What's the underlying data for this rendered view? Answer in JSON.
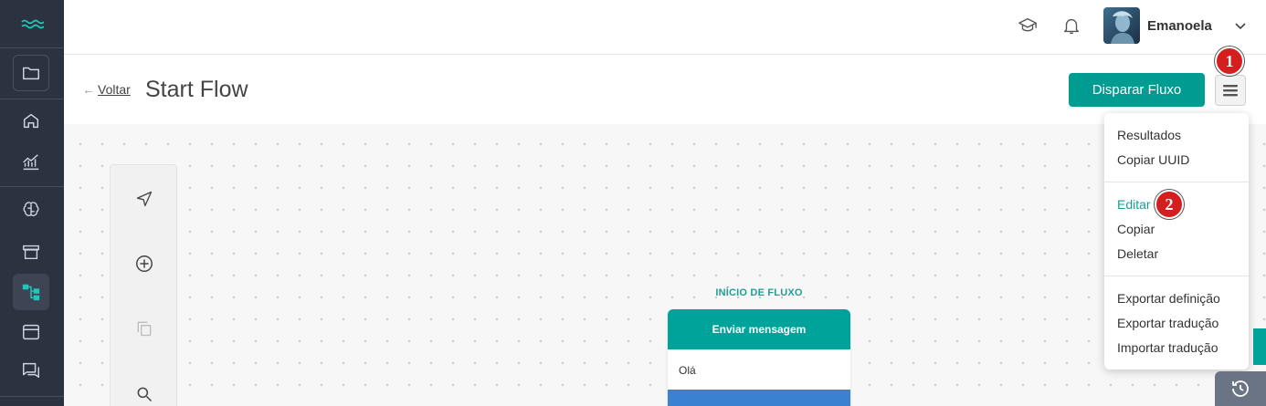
{
  "sidebar": {
    "items": [
      {
        "icon": "folder-icon"
      },
      {
        "icon": "home-icon"
      },
      {
        "icon": "analytics-icon"
      },
      {
        "icon": "brain-icon"
      },
      {
        "icon": "store-icon"
      },
      {
        "icon": "flow-icon",
        "active": true
      },
      {
        "icon": "window-icon"
      },
      {
        "icon": "chat-icon"
      }
    ]
  },
  "header": {
    "user_name": "Emanoela"
  },
  "page": {
    "back_arrow": "←",
    "back_label": "Voltar",
    "title": "Start Flow",
    "fire_button": "Disparar Fluxo"
  },
  "menu": {
    "group1": [
      "Resultados",
      "Copiar UUID"
    ],
    "group2": [
      "Editar",
      "Copiar",
      "Deletar"
    ],
    "group3": [
      "Exportar definição",
      "Exportar tradução",
      "Importar tradução"
    ]
  },
  "badges": {
    "first": "1",
    "second": "2"
  },
  "flow": {
    "start_label": "INÍCIO DE FLUXO",
    "node_title": "Enviar mensagem",
    "node_message": "Olá"
  },
  "colors": {
    "accent": "#009c92",
    "sidebar": "#2b3240",
    "badge": "#d51f1f",
    "node_footer": "#3a82d1"
  }
}
